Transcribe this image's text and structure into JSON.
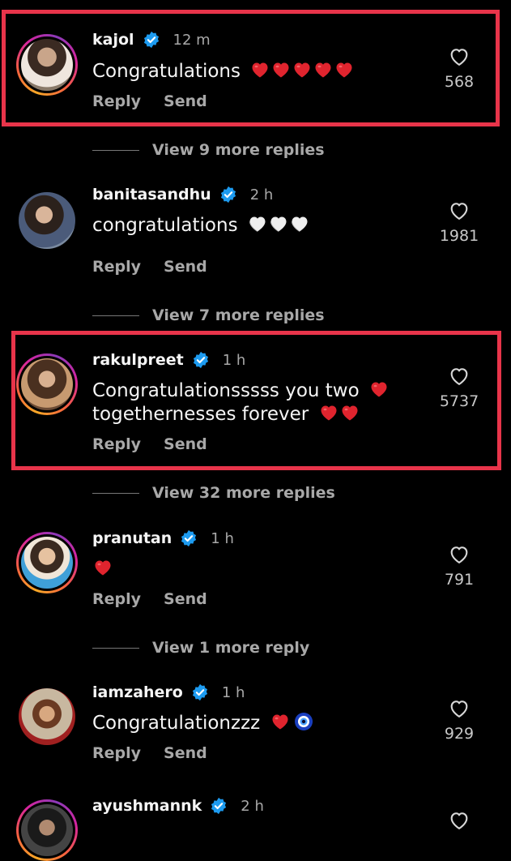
{
  "colors": {
    "background": "#000000",
    "highlight": "#e8344a",
    "verified": "#1d9bf0",
    "heart": "#e0242e"
  },
  "comments": [
    {
      "username": "kajol",
      "time": "12 m",
      "text": "Congratulations",
      "emoji": "red-heart x5",
      "likes": "568",
      "reply": "Reply",
      "send": "Send"
    },
    {
      "username": "banitasandhu",
      "time": "2 h",
      "text": "congratulations",
      "emoji": "white-heart x3",
      "likes": "1981",
      "reply": "Reply",
      "send": "Send"
    },
    {
      "username": "rakulpreet",
      "time": "1 h",
      "text_line1": "Congratulationsssss you two",
      "text_line2": "togethernesses forever",
      "likes": "5737",
      "reply": "Reply",
      "send": "Send"
    },
    {
      "username": "pranutan",
      "time": "1 h",
      "emoji": "red-heart",
      "likes": "791",
      "reply": "Reply",
      "send": "Send"
    },
    {
      "username": "iamzahero",
      "time": "1 h",
      "text": "Congratulationzzz",
      "emoji": "red-heart, nazar-amulet",
      "likes": "929",
      "reply": "Reply",
      "send": "Send"
    },
    {
      "username": "ayushmannk",
      "time": "2 h"
    }
  ],
  "view_more": [
    "View 9 more replies",
    "View 7 more replies",
    "View 32 more replies",
    "View 1 more reply"
  ]
}
